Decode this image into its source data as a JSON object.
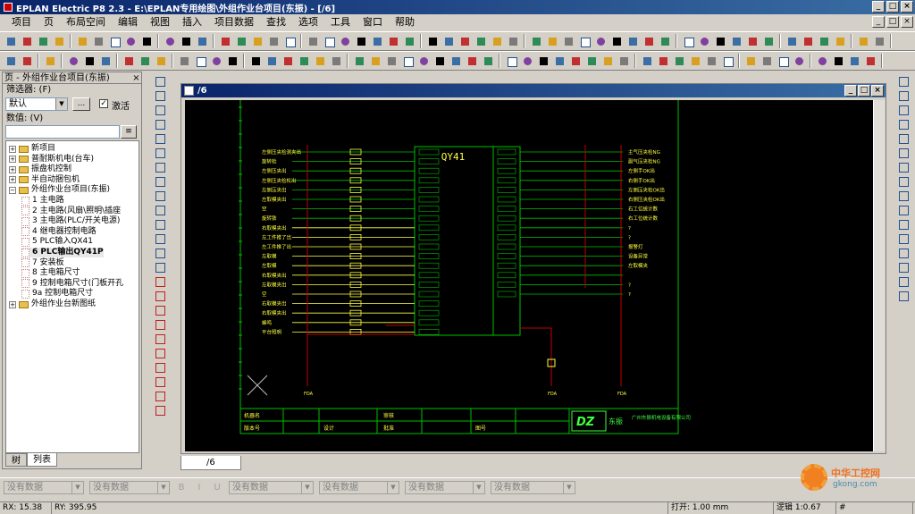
{
  "window": {
    "title": "EPLAN Electric P8 2.3 - E:\\EPLAN专用绘图\\外组作业台项目(东振) - [/6]"
  },
  "menu": [
    "项目",
    "页",
    "布局空间",
    "编辑",
    "视图",
    "插入",
    "项目数据",
    "查找",
    "选项",
    "工具",
    "窗口",
    "帮助"
  ],
  "left_panel": {
    "title": "页 - 外组作业台项目(东振)",
    "filter_label": "筛选器: (F)",
    "filter_value": "默认",
    "filter_btn": "...",
    "activate_label": "激活",
    "value_label": "数值: (V)",
    "tree": [
      {
        "label": "新项目",
        "level": 0,
        "kind": "folder",
        "expanded": false
      },
      {
        "label": "普耐斯机电(台车)",
        "level": 0,
        "kind": "folder",
        "expanded": false
      },
      {
        "label": "振盘机控制",
        "level": 0,
        "kind": "folder",
        "expanded": false
      },
      {
        "label": "半自动捆包机",
        "level": 0,
        "kind": "folder",
        "expanded": false
      },
      {
        "label": "外组作业台项目(东振)",
        "level": 0,
        "kind": "folder",
        "expanded": true
      },
      {
        "label": "1 主电路",
        "level": 1,
        "kind": "page"
      },
      {
        "label": "2 主电路(风扇\\照明\\插座",
        "level": 1,
        "kind": "page"
      },
      {
        "label": "3 主电路(PLC/开关电源)",
        "level": 1,
        "kind": "page"
      },
      {
        "label": "4 继电器控制电路",
        "level": 1,
        "kind": "page"
      },
      {
        "label": "5 PLC输入QX41",
        "level": 1,
        "kind": "page"
      },
      {
        "label": "6 PLC输出QY41P",
        "level": 1,
        "kind": "page",
        "selected": true
      },
      {
        "label": "7 安装板",
        "level": 1,
        "kind": "page"
      },
      {
        "label": "8 主电箱尺寸",
        "level": 1,
        "kind": "page"
      },
      {
        "label": "9 控制电箱尺寸(门板开孔",
        "level": 1,
        "kind": "page"
      },
      {
        "label": "9a 控制电箱尺寸",
        "level": 1,
        "kind": "page"
      },
      {
        "label": "外组作业台新图纸",
        "level": 0,
        "kind": "folder",
        "expanded": false
      }
    ],
    "tabs": [
      "树",
      "列表"
    ]
  },
  "document": {
    "title": "/6",
    "tab": "/6",
    "plc_label": "QY41",
    "left_labels": [
      "左侧压夹检测夹出",
      "旋转检",
      "左侧压夹出",
      "左侧压夹检松出",
      "左侧压夹出",
      "左取模夹出",
      "空",
      "旋转铁",
      "右取模夹出",
      "左工件推了出",
      "左工件推了出",
      "左取模",
      "左取模",
      "右取模夹出",
      "左取模夹出",
      "空",
      "右取模夹出",
      "右取模夹出",
      "蜂鸣",
      "平台照明"
    ],
    "right_labels": [
      "主气压夹检NG",
      "副气压夹检NG",
      "左侧手OK出",
      "右侧手OK出",
      "左侧压夹检OK出",
      "右侧压夹检OK出",
      "右工位统计数",
      "右工位统计数",
      "?",
      "?",
      "报警灯",
      "设备异常",
      "左取模夹",
      "",
      "?",
      "?"
    ],
    "bottom_nodes": [
      "FDA",
      "FDA",
      "FDA"
    ],
    "titleblock": {
      "r1": [
        "机器名",
        "",
        "审核",
        ""
      ],
      "r2": [
        "版本号",
        "设计",
        "批准",
        "图号"
      ],
      "logo": "DZ",
      "company_cn": "东振",
      "company_full": "广州东振机电设备有限公司"
    }
  },
  "props": {
    "fields": [
      "没有数据",
      "没有数据",
      "没有数据",
      "没有数据",
      "没有数据",
      "没有数据"
    ],
    "format_btns": [
      "B",
      "I",
      "U"
    ]
  },
  "status": {
    "rx": "RX:  15.38",
    "ry": "RY:  395.95",
    "open": "打开: 1.00 mm",
    "grid": "逻辑 1:0.67",
    "hash": "#"
  },
  "watermark": {
    "main": "中华工控网",
    "sub": "gkong.com"
  },
  "colors": {
    "canvas": "#000000",
    "frame": "#00c000",
    "wire": "#c00000",
    "text_yellow": "#ffff40",
    "text_green": "#40ff40"
  }
}
